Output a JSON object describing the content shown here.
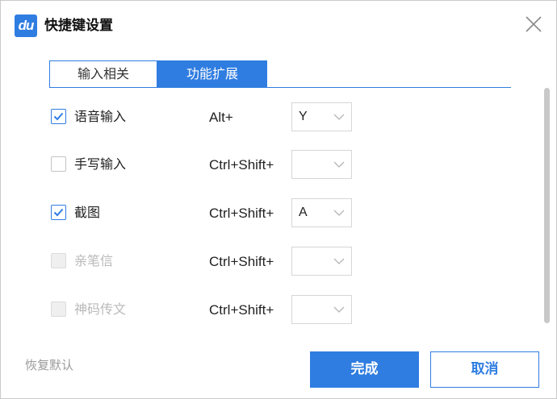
{
  "window": {
    "title": "快捷键设置",
    "logo_text": "du",
    "accent_color": "#2f7de1"
  },
  "tabs": [
    {
      "label": "输入相关",
      "active": false
    },
    {
      "label": "功能扩展",
      "active": true
    }
  ],
  "shortcuts": [
    {
      "label": "语音输入",
      "checked": true,
      "enabled": true,
      "combo": "Alt+",
      "key": "Y"
    },
    {
      "label": "手写输入",
      "checked": false,
      "enabled": true,
      "combo": "Ctrl+Shift+",
      "key": ""
    },
    {
      "label": "截图",
      "checked": true,
      "enabled": true,
      "combo": "Ctrl+Shift+",
      "key": "A"
    },
    {
      "label": "亲笔信",
      "checked": false,
      "enabled": false,
      "combo": "Ctrl+Shift+",
      "key": ""
    },
    {
      "label": "神码传文",
      "checked": false,
      "enabled": false,
      "combo": "Ctrl+Shift+",
      "key": ""
    }
  ],
  "footer": {
    "restore_label": "恢复默认",
    "done_label": "完成",
    "cancel_label": "取消"
  }
}
